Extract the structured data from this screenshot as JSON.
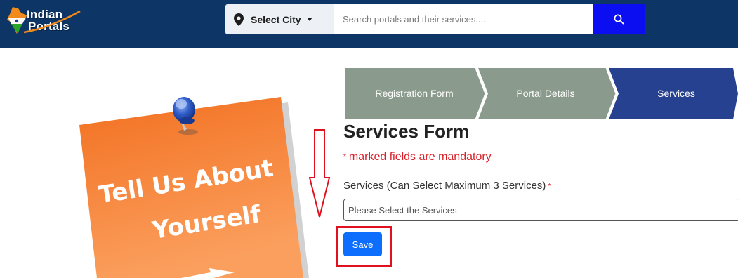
{
  "header": {
    "logo_line1": "Indian",
    "logo_line2": "Portals",
    "city_label": "Select City",
    "search_placeholder": "Search portals and their services....",
    "icons": {
      "location": "map-pin-icon",
      "search": "search-icon",
      "caret": "chevron-down-icon"
    }
  },
  "note": {
    "line1": "Tell Us About",
    "line2": "Yourself"
  },
  "stepper": {
    "steps": [
      {
        "label": "Registration Form",
        "state": "done"
      },
      {
        "label": "Portal Details",
        "state": "done"
      },
      {
        "label": "Services",
        "state": "active"
      }
    ]
  },
  "form": {
    "title": "Services Form",
    "mandatory_star": "*",
    "mandatory_text": "marked fields are mandatory",
    "services_label": "Services (Can Select Maximum 3 Services)",
    "services_star": "*",
    "services_placeholder": "Please Select the Services",
    "save_label": "Save"
  },
  "colors": {
    "header_bg": "#0d3566",
    "search_button": "#0a0ef0",
    "step_done": "#8a9a8c",
    "step_active": "#25418f",
    "note_orange": "#f47d2a",
    "mandatory_red": "#d9222a",
    "save_button": "#0d6efd",
    "annotation_red": "#e0101e"
  }
}
